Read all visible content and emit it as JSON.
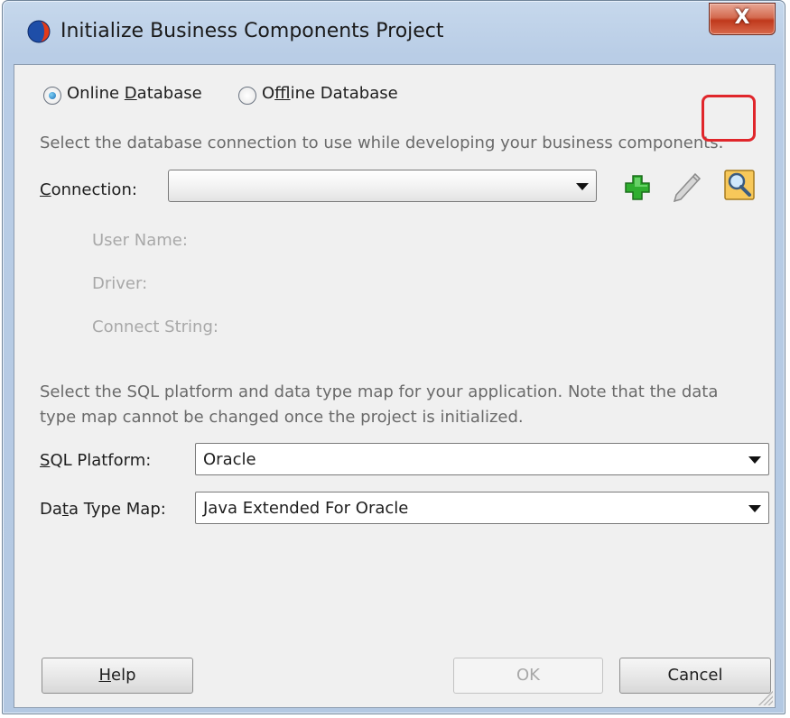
{
  "window": {
    "title": "Initialize Business Components Project",
    "close_label": "X"
  },
  "mode": {
    "online": {
      "pre": "Online ",
      "key": "D",
      "post": "atabase",
      "checked": true
    },
    "offline": {
      "pre": "O",
      "key": "f",
      "post": "fline Database",
      "checked": false
    }
  },
  "connection": {
    "hint": "Select the database connection to use while developing your business components.",
    "label_key": "C",
    "label_rest": "onnection:",
    "value": "",
    "details": {
      "user_name": "User Name:",
      "driver": "Driver:",
      "connect_string": "Connect String:"
    },
    "icons": [
      "add-icon",
      "edit-pencil-icon",
      "browse-search-icon"
    ]
  },
  "platform": {
    "hint_line1": "Select the SQL platform and data type map for your application.  Note that the data",
    "hint_line2": "type map cannot be changed once the project is initialized.",
    "sql_label_key": "S",
    "sql_label_rest": "QL Platform:",
    "sql_value": "Oracle",
    "map_label_pre": "Da",
    "map_label_key": "t",
    "map_label_post": "a Type Map:",
    "map_value": "Java Extended For Oracle"
  },
  "buttons": {
    "help_key": "H",
    "help_rest": "elp",
    "ok": "OK",
    "cancel": "Cancel"
  },
  "colors": {
    "highlight": "#e0262b",
    "add_icon": "#2fae2f"
  }
}
